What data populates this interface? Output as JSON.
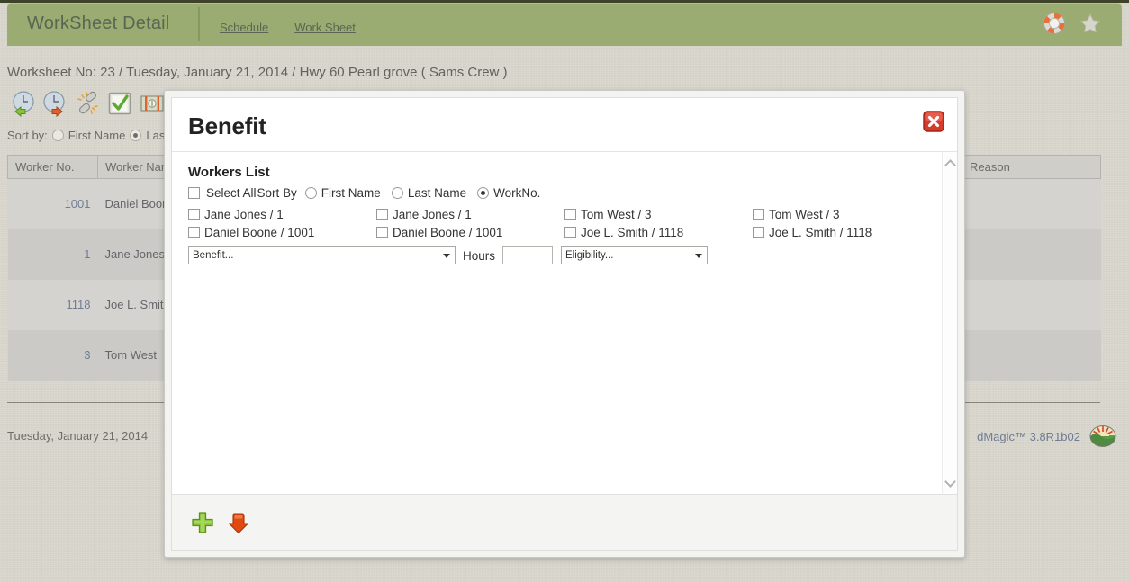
{
  "header": {
    "title": "WorkSheet Detail",
    "links": [
      {
        "label": "Schedule"
      },
      {
        "label": "Work Sheet"
      }
    ],
    "icons": {
      "help": "lifebuoy-icon",
      "favorite": "star-icon"
    }
  },
  "page": {
    "worksheet_line": "Worksheet No: 23 / Tuesday, January 21, 2014 / Hwy 60 Pearl grove ( Sams Crew )",
    "sort_by_label": "Sort by:",
    "sort_options": [
      {
        "label": "First Name",
        "selected": false
      },
      {
        "label": "Last Name",
        "selected": true
      }
    ],
    "toolbar_icons": [
      "clock-in-icon",
      "clock-out-icon",
      "broken-link-icon",
      "approve-check-icon",
      "payroll-icon"
    ]
  },
  "table": {
    "columns": [
      "Worker No.",
      "Worker Name",
      "Reason"
    ],
    "rows": [
      {
        "worker_no": "1001",
        "worker_name": "Daniel Boone",
        "reason": ""
      },
      {
        "worker_no": "1",
        "worker_name": "Jane Jones",
        "reason": ""
      },
      {
        "worker_no": "1118",
        "worker_name": "Joe L. Smith",
        "reason": ""
      },
      {
        "worker_no": "3",
        "worker_name": "Tom West",
        "reason": ""
      }
    ]
  },
  "footer": {
    "date": "Tuesday, January 21, 2014",
    "version": "dMagic™ 3.8R1b02",
    "logo": "sunrise-logo-icon"
  },
  "modal": {
    "title": "Benefit",
    "close_label": "close-icon",
    "section_title": "Workers List",
    "select_all_label": "Select All",
    "sort_by_label": "Sort By",
    "sort_options": [
      {
        "label": "First Name",
        "selected": false
      },
      {
        "label": "Last Name",
        "selected": false
      },
      {
        "label": "WorkNo.",
        "selected": true
      }
    ],
    "workers": [
      {
        "label": "Jane Jones / 1",
        "checked": false
      },
      {
        "label": "Jane Jones / 1",
        "checked": false
      },
      {
        "label": "Tom West / 3",
        "checked": false
      },
      {
        "label": "Tom West / 3",
        "checked": false
      },
      {
        "label": "Daniel Boone / 1001",
        "checked": false
      },
      {
        "label": "Daniel Boone / 1001",
        "checked": false
      },
      {
        "label": "Joe L. Smith / 1118",
        "checked": false
      },
      {
        "label": "Joe L. Smith / 1118",
        "checked": false
      }
    ],
    "benefit_select": {
      "value": "Benefit...",
      "options": [
        "Benefit..."
      ]
    },
    "hours_label": "Hours",
    "hours_input": {
      "value": "",
      "placeholder": ""
    },
    "eligibility_select": {
      "value": "Eligibility...",
      "options": [
        "Eligibility..."
      ]
    },
    "footer_buttons": [
      {
        "name": "add-button",
        "icon": "green-plus-icon"
      },
      {
        "name": "save-down-button",
        "icon": "orange-down-arrow-icon"
      }
    ],
    "scrollbar": {
      "up": "chevron-up-icon",
      "down": "chevron-down-icon"
    }
  },
  "colors": {
    "header_green": "#9aac71",
    "page_bg": "#d9d7cd",
    "accent_blue": "#6f7c93",
    "close_red": "#d93b2b",
    "plus_green": "#7ec01e",
    "arrow_orange": "#e04a10"
  }
}
